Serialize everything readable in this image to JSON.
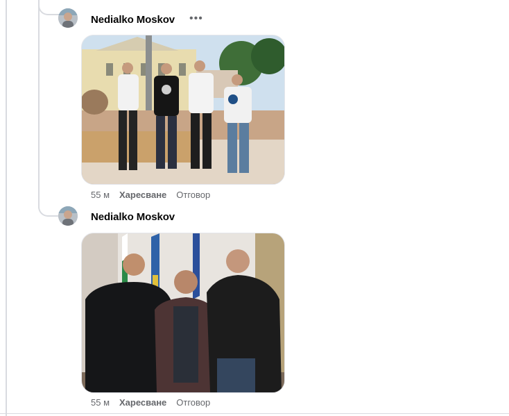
{
  "comments": [
    {
      "author": "Nedialko Moskov",
      "time": "55 м",
      "like_label": "Харесване",
      "reply_label": "Отговор",
      "more_icon": "more-horizontal-icon",
      "photo": "group-photo-four-men-plaza"
    },
    {
      "author": "Nedialko Moskov",
      "time": "55 м",
      "like_label": "Харесване",
      "reply_label": "Отговор",
      "photo": "group-photo-three-men-office"
    }
  ],
  "colors": {
    "thread_line": "#d9dbe0",
    "meta_text": "#65676b",
    "author_text": "#050505"
  }
}
